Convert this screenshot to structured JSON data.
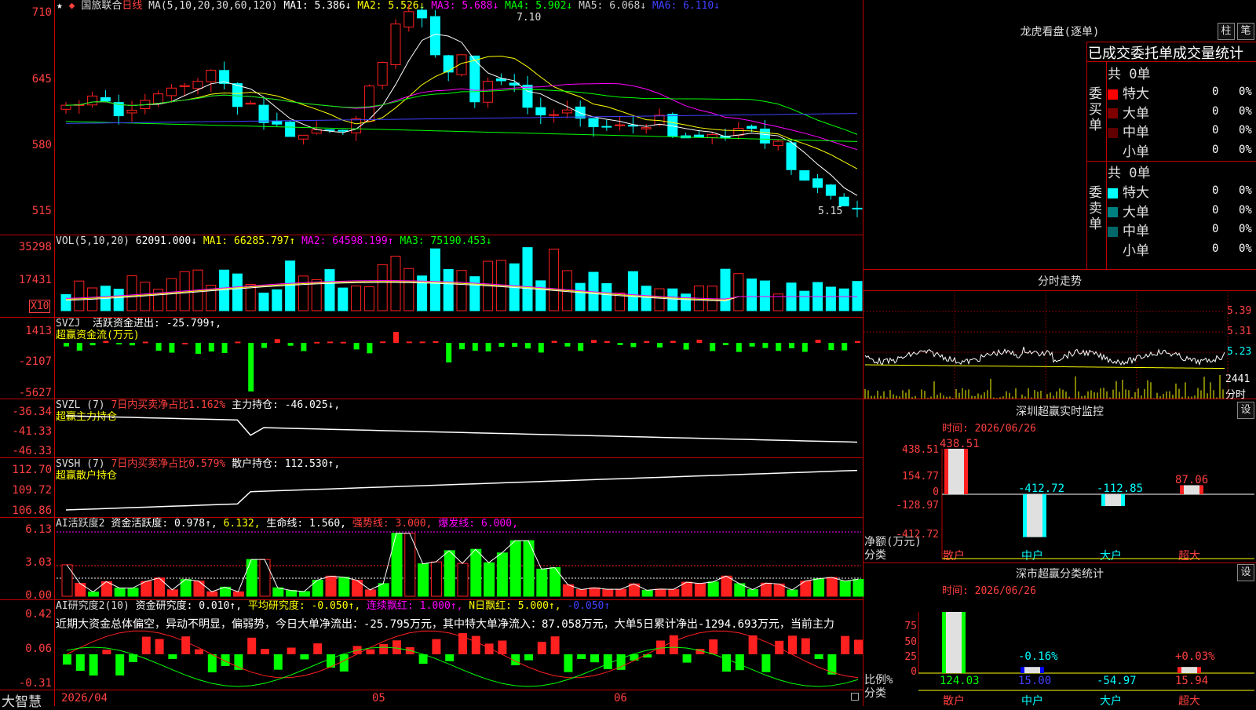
{
  "stock": {
    "name": "国旅联合",
    "period": "日线",
    "star": "★",
    "marker": "◆"
  },
  "main": {
    "ma_label": "MA(5,10,20,30,60,120)",
    "ma1": "MA1: 5.386↓",
    "ma2": "MA2: 5.526↓",
    "ma3": "MA3: 5.688↓",
    "ma4": "MA4: 5.902↓",
    "ma5": "MA5: 6.068↓",
    "ma6": "MA6: 6.110↓",
    "y_ticks": [
      "710",
      "645",
      "580",
      "515"
    ],
    "high_label": "7.10",
    "low_label": "5.15"
  },
  "vol": {
    "label": "VOL(5,10,20)",
    "value": "62091.000↓",
    "ma1": "MA1: 66285.797↑",
    "ma2": "MA2: 64598.199↑",
    "ma3": "MA3: 75190.453↓",
    "y_ticks": [
      "35298",
      "17431"
    ],
    "unit": "X10"
  },
  "svzj": {
    "label": "SVZJ",
    "text": "活跃资金进出: -25.799↑,",
    "sub": "超赢资金流(万元)",
    "y_ticks": [
      "1413",
      "-2107",
      "-5627"
    ]
  },
  "svzl": {
    "label": "SVZL (7)",
    "text1": "7日内买卖净占比1.162%",
    "text2": "主力持仓: -46.025↓,",
    "sub": "超赢主力持仓",
    "y_ticks": [
      "-36.34",
      "-41.33",
      "-46.33"
    ]
  },
  "svsh": {
    "label": "SVSH (7)",
    "text1": "7日内买卖净占比0.579%",
    "text2": "散户持仓: 112.530↑,",
    "sub": "超赢散户持仓",
    "y_ticks": [
      "112.70",
      "109.72",
      "106.86"
    ]
  },
  "ai1": {
    "label": "AI活跃度2",
    "t1": "资金活跃度: 0.978↑,",
    "t2": "6.132,",
    "t3": "生命线: 1.560,",
    "t4": "强势线: 3.000,",
    "t5": "爆发线: 6.000,",
    "y_ticks": [
      "6.13",
      "3.03",
      "0.00"
    ]
  },
  "ai2": {
    "label": "AI研究度2(10)",
    "t1": "资金研究度: 0.010↑,",
    "t2": "平均研究度: -0.050↑,",
    "t3": "连续飘红: 1.000↑,",
    "t4": "N日飘红: 5.000↑,",
    "t5": "-0.050↑",
    "comment": "近期大资金总体偏空，异动不明显，偏弱势，今日大单净流出：-25.795万元，其中特大单净流入：87.058万元，大单5日累计净出-1294.693万元，当前主力",
    "y_ticks": [
      "0.42",
      "0.06",
      "-0.31"
    ]
  },
  "bottom": {
    "brand": "大智慧",
    "date": "2026/04",
    "m1": "05",
    "m2": "06"
  },
  "dragon": {
    "title": "龙虎看盘(逐单)",
    "btn1": "柱",
    "btn2": "笔",
    "header": "已成交委托单成交量统计",
    "buy_label": "委买单",
    "sell_label": "委卖单",
    "buy_total": "共 0单",
    "sell_total": "共 0单",
    "buy_rows": [
      {
        "name": "特大",
        "v": "0",
        "p": "0%",
        "color": "#ff0000"
      },
      {
        "name": "大单",
        "v": "0",
        "p": "0%",
        "color": "#800000"
      },
      {
        "name": "中单",
        "v": "0",
        "p": "0%",
        "color": "#600000"
      },
      {
        "name": "小单",
        "v": "0",
        "p": "0%",
        "color": "#000000"
      }
    ],
    "sell_rows": [
      {
        "name": "特大",
        "v": "0",
        "p": "0%",
        "color": "#00ffff"
      },
      {
        "name": "大单",
        "v": "0",
        "p": "0%",
        "color": "#008080"
      },
      {
        "name": "中单",
        "v": "0",
        "p": "0%",
        "color": "#006868"
      },
      {
        "name": "小单",
        "v": "0",
        "p": "0%",
        "color": "#000000"
      }
    ]
  },
  "intraday": {
    "title": "分时走势",
    "y_ticks": [
      "5.39",
      "5.31",
      "5.23"
    ],
    "vol": "2441",
    "unit": "分时"
  },
  "monitor": {
    "title": "深圳超赢实时监控",
    "btn": "设",
    "time": "时间: 2026/06/26",
    "y_ticks": [
      "438.51",
      "154.77",
      "0",
      "-128.97",
      "-412.72"
    ],
    "ylabel1": "净额(万元)",
    "ylabel2": "分类",
    "bars": [
      {
        "cat": "散户",
        "val": "438.51",
        "value": 438.51
      },
      {
        "cat": "中户",
        "val": "-412.72",
        "value": -412.72
      },
      {
        "cat": "大户",
        "val": "-112.85",
        "value": -112.85
      },
      {
        "cat": "超大",
        "val": "87.06",
        "value": 87.06
      }
    ]
  },
  "stats": {
    "title": "深市超赢分类统计",
    "btn": "设",
    "time": "时间: 2026/06/26",
    "y_ticks": [
      "75",
      "50",
      "25",
      "0"
    ],
    "ylabel1": "比例%",
    "ylabel2": "分类",
    "bars": [
      {
        "cat": "散户",
        "pct": "",
        "val": "124.03",
        "value": 100
      },
      {
        "cat": "中户",
        "pct": "-0.16%",
        "val": "15.00",
        "value": 10
      },
      {
        "cat": "大户",
        "pct": "",
        "val": "-54.97",
        "value": 0
      },
      {
        "cat": "超大",
        "pct": "+0.03%",
        "val": "15.94",
        "value": 10
      }
    ]
  },
  "colors": {
    "up": "#ff2020",
    "down": "#00ffff",
    "frame": "#c00000",
    "ma1": "#ffffff",
    "ma2": "#ffff00",
    "ma3": "#ff00ff",
    "ma4": "#00ff00",
    "ma5": "#00ff00",
    "ma6": "#4040ff"
  }
}
